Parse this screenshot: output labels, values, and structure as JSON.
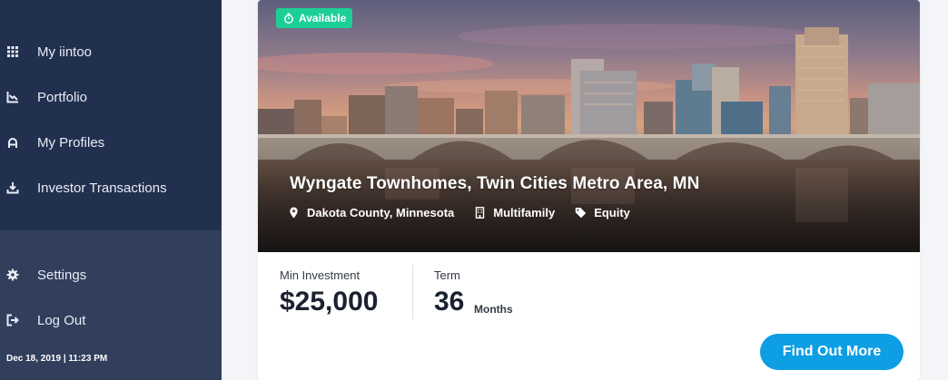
{
  "sidebar": {
    "items": [
      {
        "label": "My iintoo",
        "icon": "grid-icon"
      },
      {
        "label": "Portfolio",
        "icon": "chart-icon"
      },
      {
        "label": "My Profiles",
        "icon": "profile-icon"
      },
      {
        "label": "Investor Transactions",
        "icon": "download-tray-icon"
      }
    ],
    "bottom_items": [
      {
        "label": "Settings",
        "icon": "gear-icon"
      },
      {
        "label": "Log Out",
        "icon": "logout-icon"
      }
    ],
    "timestamp": "Dec 18, 2019 | 11:23 PM"
  },
  "card": {
    "badge": "Available",
    "title": "Wyngate Townhomes, Twin Cities Metro Area, MN",
    "location": "Dakota County, Minnesota",
    "property_type": "Multifamily",
    "investment_type": "Equity",
    "min_investment_label": "Min Investment",
    "min_investment_value": "$25,000",
    "term_label": "Term",
    "term_value": "36",
    "term_unit": "Months",
    "cta": "Find Out More"
  },
  "colors": {
    "sidebar_bg": "#22304f",
    "sidebar_lower_bg": "#313e5c",
    "badge_green": "#1ccf96",
    "cta_blue": "#0d9ee3"
  }
}
